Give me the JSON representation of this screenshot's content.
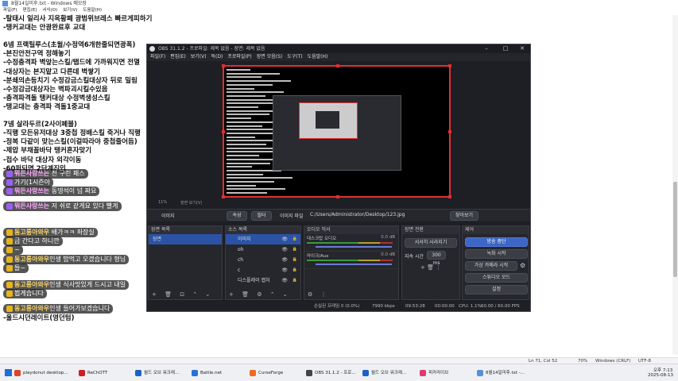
{
  "notepad": {
    "title": "8월14일미후.txt - Windows 메모장",
    "menu": [
      "파일(F)",
      "편집(E)",
      "서식(O)",
      "보기(V)",
      "도움말(H)"
    ],
    "lines": [
      "-탈태시 일리사 지옥황폐 광범위브레스 빠르게피하기",
      "-탱커교대는 안광완료후 교대",
      "",
      "6넴 프랙틸루스(초월/수정역6개한줄되면광폭)",
      "-본진안전구역 정해놓기",
      "-수정충격파 벽앞는스킬/탭드에 가까워지면 전멸",
      "-대상자는 본지맡고 다른데 벽쌓기",
      "-분쇄의손등치기 수정감금스킬대상자 뒤로 밀림",
      "-수정감금대상자는 벽파괴시킬수있음",
      "-충격파격돌 탱커대상 수정벽생성스킬",
      "-탱교대는 충격파 격돌1중교대",
      "",
      "7넴 살라두르(2사이페블)",
      "-직행 모든유저대상 3중첩 정배스킬 죽거나 직행",
      "-정복 다같이 맞는스킬(이걸따라야 중첩줄어듬)",
      "-제압 부채꼴바닥 탱커혼자맞기",
      "-접수 바닥 대상자 외각이동",
      "-60퍼되면 2단계진입",
      "",
      "",
      "",
      "",
      "",
      "",
      "",
      "",
      "",
      "",
      "",
      "",
      "",
      "",
      "",
      "",
      "-울드시던레이트(영던텀)"
    ],
    "status": {
      "position": "Ln 71, Col 52",
      "zoom": "70%",
      "eol": "Windows (CRLF)",
      "encoding": "UTF-8"
    }
  },
  "chat": [
    {
      "name": "뭐든사랑쓰는",
      "text": " 전 구린 패스",
      "type": "p"
    },
    {
      "name": "",
      "text": "가기(1시즌아",
      "type": "p"
    },
    {
      "name": "뭐든사랑쓰는",
      "text": " 동댕석이 넘 짜요",
      "type": "p"
    },
    {
      "name": "뭐든사랑쓰는",
      "text": " 저 쉬로 같게요 있다 빨게",
      "type": "p"
    },
    {
      "name": "동고롱아와우",
      "text": " 배가ㅋㅋ 좌장실",
      "type": "y"
    },
    {
      "name": "",
      "text": "금 간다고 하니깐",
      "type": "y"
    },
    {
      "name": "",
      "text": "~",
      "type": "y"
    },
    {
      "name": "동고롱아와우",
      "text": "인생 밥먹고 오겠습니다 형님",
      "type": "y"
    },
    {
      "name": "",
      "text": "들~",
      "type": "y"
    },
    {
      "name": "동고롱아와우",
      "text": "인생 식사맛있게 드시고 내일",
      "type": "y"
    },
    {
      "name": "",
      "text": "뵙게습니다",
      "type": "y"
    },
    {
      "name": "동고롱아와우",
      "text": "인생 들어가보겠습니다",
      "type": "y"
    }
  ],
  "obs": {
    "title": "OBS 31.1.2 - 프로파일: 제목 없음 - 장면: 제목 없음",
    "menu": [
      "파일(F)",
      "편집(E)",
      "보기(V)",
      "독(D)",
      "프로파일(P)",
      "장면 모음(S)",
      "도구(T)",
      "도움말(H)"
    ],
    "zoom_label": "11%",
    "preview_label": "장면 보기(V)",
    "ctrl": {
      "source_name": "이미지",
      "props": "속성",
      "filter": "필터",
      "file_label": "이미지 파일",
      "path": "C:/Users/Administrator/Desktop/123.jpg",
      "browse": "찾아보기"
    },
    "scenes": {
      "header": "장면 목록",
      "items": [
        "장면"
      ]
    },
    "sources": {
      "header": "소스 목록",
      "items": [
        "이미지",
        "oh",
        "ch",
        "c",
        "디스플레이 캡처"
      ]
    },
    "mixer": {
      "header": "오디오 믹서",
      "channels": [
        {
          "name": "데스크탑 오디오",
          "db": "0.0 dB"
        },
        {
          "name": "마이크/Aux",
          "db": "0.0 dB"
        }
      ]
    },
    "transition": {
      "header": "장면 전환",
      "type": "서서히 사라지기",
      "duration_label": "지속 시간",
      "duration": "300 ms"
    },
    "controls": {
      "header": "제어",
      "items": [
        "방송 중단",
        "녹화 시작",
        "가상 카메라 시작",
        "스튜디오 모드",
        "설정"
      ]
    },
    "status": {
      "dropped": "손실된 프레임 0 (0.0%)",
      "bitrate": "7990 kbps",
      "live_time": "09:53:28",
      "rec_time": "00:00:00",
      "cpu": "CPU: 1.1%",
      "fps": "60.00 / 60.00 FPS"
    }
  },
  "taskbar": {
    "items": [
      "playdonut desktop...",
      "ReChOTT",
      "월드 오브 워크래...",
      "Battle.net",
      "CurseForge",
      "OBS 31.1.2 - 프로...",
      "월드 오브 워크래...",
      "피카라이브",
      "8월14일미후.txt -..."
    ],
    "time": "오후 7:13",
    "date": "2025-08-13"
  },
  "colors": {
    "accent": "#3e66c7",
    "preview_border": "#e03030",
    "obs_bg": "#1e1f24"
  }
}
